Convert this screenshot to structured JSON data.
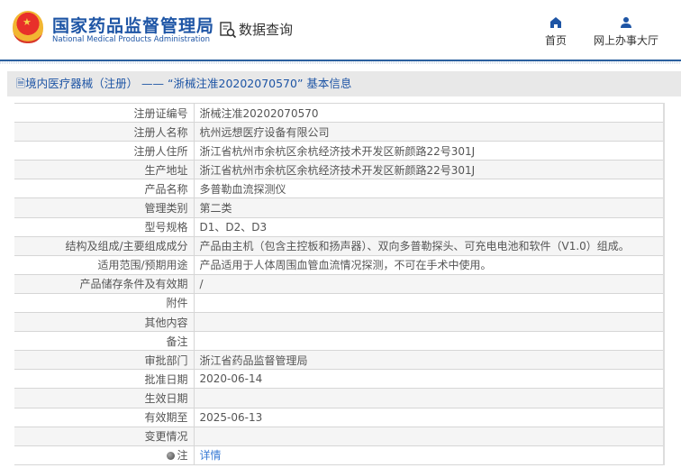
{
  "header": {
    "brand_cn": "国家药品监督管理局",
    "brand_en": "National Medical Products Administration",
    "section": "数据查询",
    "nav": [
      {
        "label": "首页",
        "icon": "home-icon"
      },
      {
        "label": "网上办事大厅",
        "icon": "user-icon"
      }
    ]
  },
  "title": "境内医疗器械（注册） —— “浙械注准20202070570” 基本信息",
  "rows": [
    {
      "label": "注册证编号",
      "value": "浙械注准20202070570"
    },
    {
      "label": "注册人名称",
      "value": "杭州远想医疗设备有限公司"
    },
    {
      "label": "注册人住所",
      "value": "浙江省杭州市余杭区余杭经济技术开发区新颜路22号301J"
    },
    {
      "label": "生产地址",
      "value": "浙江省杭州市余杭区余杭经济技术开发区新颜路22号301J"
    },
    {
      "label": "产品名称",
      "value": "多普勒血流探测仪"
    },
    {
      "label": "管理类别",
      "value": "第二类"
    },
    {
      "label": "型号规格",
      "value": "D1、D2、D3"
    },
    {
      "label": "结构及组成/主要组成成分",
      "value": "产品由主机（包含主控板和扬声器）、双向多普勒探头、可充电电池和软件（V1.0）组成。"
    },
    {
      "label": "适用范围/预期用途",
      "value": "产品适用于人体周围血管血流情况探测，不可在手术中使用。"
    },
    {
      "label": "产品储存条件及有效期",
      "value": "/"
    },
    {
      "label": "附件",
      "value": ""
    },
    {
      "label": "其他内容",
      "value": ""
    },
    {
      "label": "备注",
      "value": ""
    },
    {
      "label": "审批部门",
      "value": "浙江省药品监督管理局"
    },
    {
      "label": "批准日期",
      "value": "2020-06-14"
    },
    {
      "label": "生效日期",
      "value": ""
    },
    {
      "label": "有效期至",
      "value": "2025-06-13"
    },
    {
      "label": "变更情况",
      "value": ""
    },
    {
      "label": "注",
      "value": "详情"
    }
  ]
}
